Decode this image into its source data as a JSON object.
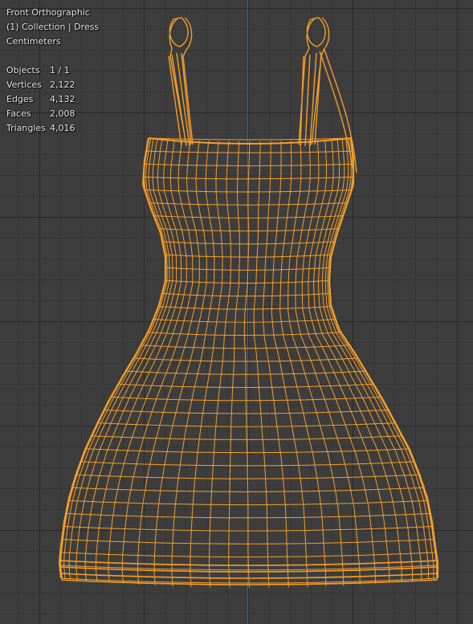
{
  "viewport": {
    "view_name": "Front Orthographic",
    "collection_label": "(1) Collection | Dress",
    "units": "Centimeters",
    "stats": [
      {
        "label": "Objects",
        "value": "1 / 1"
      },
      {
        "label": "Vertices",
        "value": "2,122"
      },
      {
        "label": "Edges",
        "value": "4,132"
      },
      {
        "label": "Faces",
        "value": "2,008"
      },
      {
        "label": "Triangles",
        "value": "4,016"
      }
    ]
  },
  "colors": {
    "background": "#3d3d3d",
    "selected_wire": "#f59e2a",
    "z_axis": "#3b5ea8",
    "overlay_text": "#e8e8e8"
  },
  "object": {
    "name": "Dress",
    "selected": true,
    "display": "wireframe"
  }
}
